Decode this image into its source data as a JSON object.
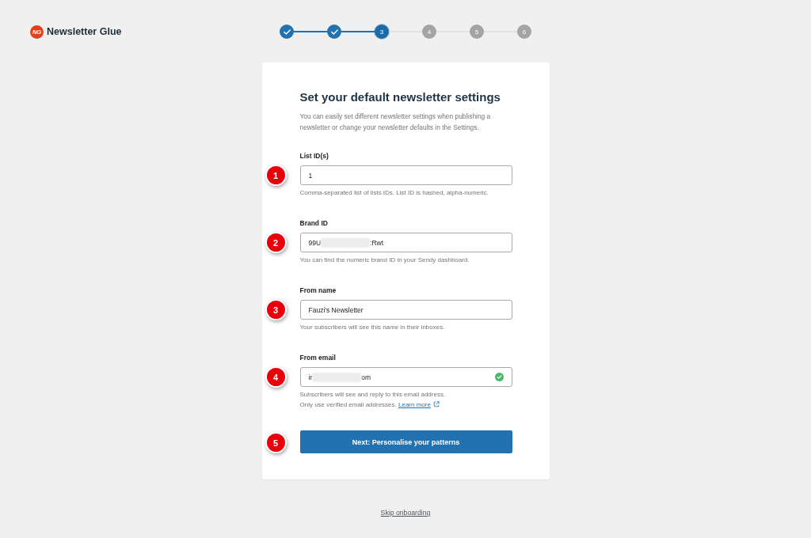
{
  "logo": {
    "mark": "NG",
    "name": "Newsletter Glue"
  },
  "steps": [
    {
      "completed": true,
      "selected": false
    },
    {
      "completed": true,
      "selected": false
    },
    {
      "label": "3",
      "completed": false,
      "selected": true
    },
    {
      "label": "4",
      "completed": false,
      "selected": false
    },
    {
      "label": "5",
      "completed": false,
      "selected": false
    },
    {
      "label": "6",
      "completed": false,
      "selected": false
    }
  ],
  "card": {
    "title": "Set your default newsletter settings",
    "description": "You can easily set different newsletter settings when publishing a newsletter or change your newsletter defaults in the Settings.",
    "fields": [
      {
        "label": "List ID(s)",
        "marker": "1",
        "value": [
          {
            "kind": "text",
            "text": "1"
          }
        ],
        "verified": false,
        "help": [
          "Comma-separated list of lists IDs. List ID is hashed, alpha-numeric."
        ]
      },
      {
        "label": "Brand ID",
        "marker": "2",
        "value": [
          {
            "kind": "text",
            "text": "99U"
          },
          {
            "kind": "redacted"
          },
          {
            "kind": "text",
            "text": ":Rwt"
          }
        ],
        "verified": false,
        "help": [
          "You can find the numeric brand ID in your Sendy dashboard."
        ]
      },
      {
        "label": "From name",
        "marker": "3",
        "value": [
          {
            "kind": "text",
            "text": "Fauzi's Newsletter"
          }
        ],
        "verified": false,
        "help": [
          "Your subscribers will see this name in their inboxes."
        ]
      },
      {
        "label": "From email",
        "marker": "4",
        "value": [
          {
            "kind": "text",
            "text": "ir"
          },
          {
            "kind": "redacted"
          },
          {
            "kind": "text",
            "text": "om"
          }
        ],
        "verified": true,
        "help": [
          "Subscribers will see and reply to this email address.",
          "Only use verified email addresses."
        ],
        "help_link": "Learn more"
      }
    ],
    "next_button": {
      "label": "Next: Personalise your patterns",
      "marker": "5"
    }
  },
  "skip_link": "Skip onboarding"
}
